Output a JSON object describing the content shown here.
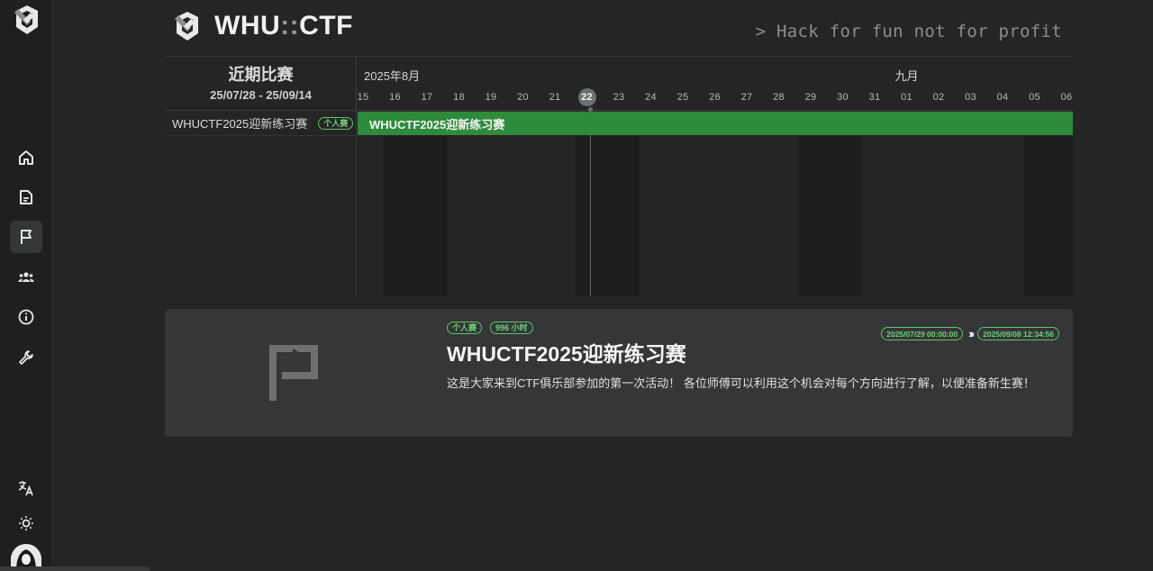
{
  "sidebar": {
    "items": [
      {
        "name": "home",
        "icon": "home-icon"
      },
      {
        "name": "posts",
        "icon": "document-icon"
      },
      {
        "name": "games",
        "icon": "flag-icon",
        "active": true
      },
      {
        "name": "teams",
        "icon": "users-icon"
      },
      {
        "name": "about",
        "icon": "info-icon"
      },
      {
        "name": "admin",
        "icon": "wrench-icon"
      }
    ],
    "bottom": [
      {
        "name": "language",
        "icon": "translate-icon"
      },
      {
        "name": "theme",
        "icon": "sun-icon"
      },
      {
        "name": "account",
        "icon": "avatar"
      }
    ]
  },
  "header": {
    "title_left": "WHU",
    "title_colons": "::",
    "title_right": "CTF",
    "slogan": "> Hack for fun not for profit"
  },
  "gantt": {
    "heading": "近期比赛",
    "range": "25/07/28 - 25/09/14",
    "months": [
      {
        "label": "2025年8月",
        "day_index": 0
      },
      {
        "label": "九月",
        "day_index": 17
      }
    ],
    "days": [
      "15",
      "16",
      "17",
      "18",
      "19",
      "20",
      "21",
      "22",
      "23",
      "24",
      "25",
      "26",
      "27",
      "28",
      "29",
      "30",
      "31",
      "01",
      "02",
      "03",
      "04",
      "05",
      "06"
    ],
    "today_index": 7,
    "weekend_ranges": [
      [
        1,
        2
      ],
      [
        7,
        8
      ],
      [
        14,
        15
      ],
      [
        21,
        22
      ]
    ],
    "rows": [
      {
        "name": "WHUCTF2025迎新练习赛",
        "tag": "个人赛",
        "bar_label": "WHUCTF2025迎新练习赛"
      }
    ]
  },
  "card": {
    "tags": [
      "个人赛",
      "996 小时"
    ],
    "title": "WHUCTF2025迎新练习赛",
    "description": "这是大家来到CTF俱乐部参加的第一次活动！ 各位师傅可以利用这个机会对每个方向进行了解，以便准备新生赛！",
    "start": "2025/07/29 00:00:00",
    "arrows": "›››",
    "end": "2025/09/08 12:34:56"
  },
  "colors": {
    "accent": "#2e8b3c",
    "tag": "#5ec26a",
    "background": "#252525",
    "sidebar": "#1f1f1f",
    "card": "#343637"
  }
}
